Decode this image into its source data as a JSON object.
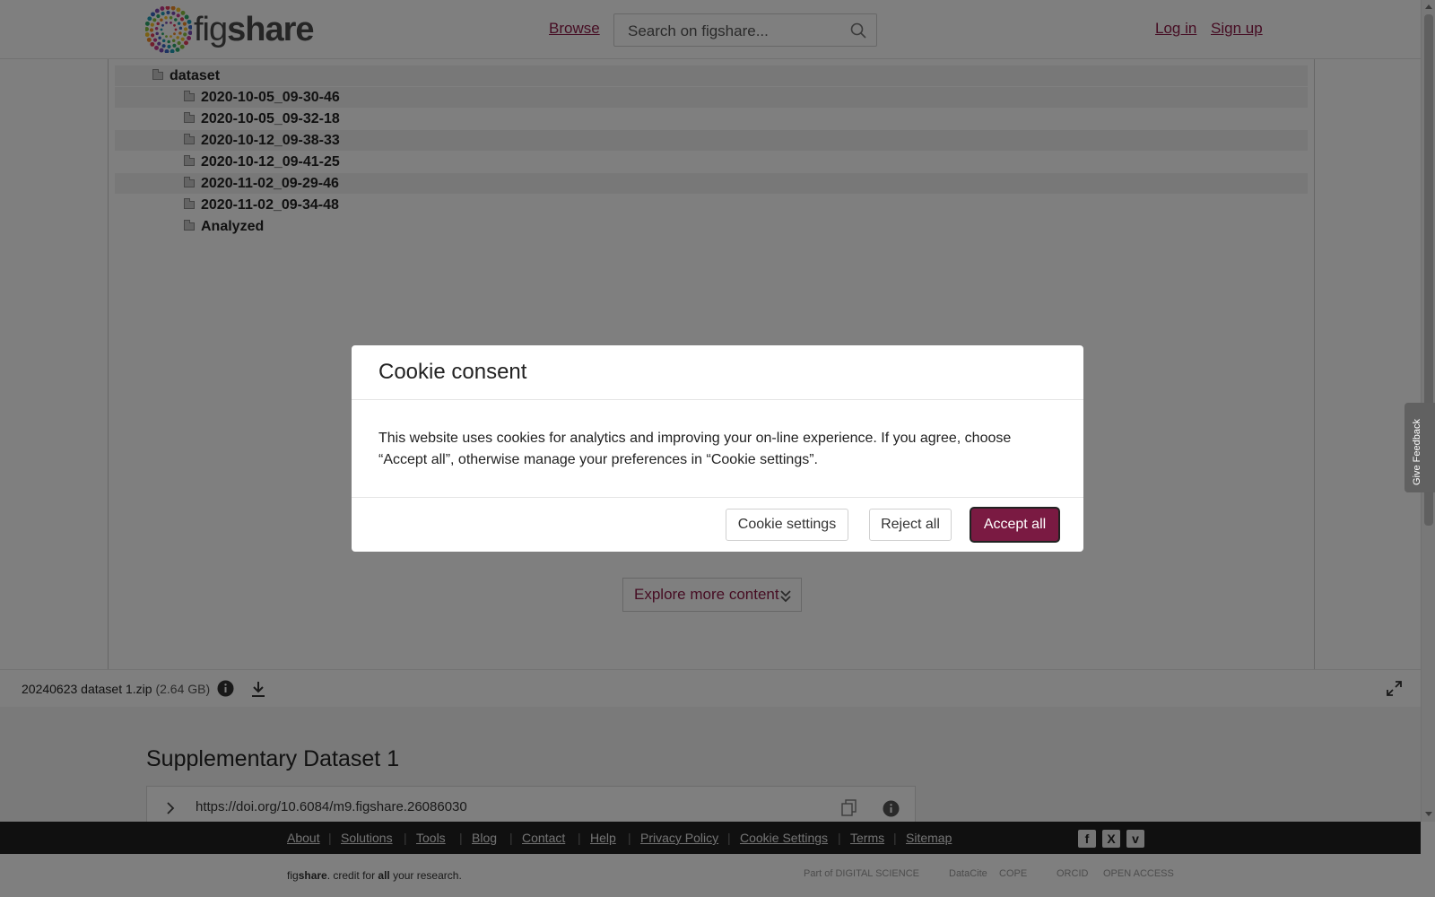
{
  "header": {
    "logo_word_light": "fig",
    "logo_word_bold": "share",
    "browse": "Browse",
    "search_placeholder": "Search on figshare...",
    "login": "Log in",
    "signup": "Sign up"
  },
  "tree": {
    "root": "dataset",
    "children": [
      "2020-10-05_09-30-46",
      "2020-10-05_09-32-18",
      "2020-10-12_09-38-33",
      "2020-10-12_09-41-25",
      "2020-11-02_09-29-46",
      "2020-11-02_09-34-48",
      "Analyzed"
    ]
  },
  "explore": "Explore more content",
  "file": {
    "name": "20240623 dataset 1.zip",
    "size": "(2.64 GB)"
  },
  "item": {
    "title": "Supplementary Dataset 1",
    "doi": "https://doi.org/10.6084/m9.figshare.26086030"
  },
  "footer": {
    "links": [
      "About",
      "Solutions",
      "Tools",
      "Blog",
      "Contact",
      "Help",
      "Privacy Policy",
      "Cookie Settings",
      "Terms",
      "Sitemap"
    ],
    "social": [
      "f",
      "X",
      "v"
    ],
    "tagline_light": "fig",
    "tagline_bold": "share",
    "tagline_rest1": ". credit for ",
    "tagline_all": "all",
    "tagline_rest2": " your research.",
    "partners": [
      "Part of DIGITAL SCIENCE",
      "DataCite",
      "COPE",
      "ORCID",
      "OPEN ACCESS"
    ]
  },
  "feedback": "Give Feedback",
  "modal": {
    "title": "Cookie consent",
    "body": "This website uses cookies for analytics and improving your on-line experience. If you agree, choose “Accept all”, otherwise manage your preferences in “Cookie settings”.",
    "settings": "Cookie settings",
    "reject": "Reject all",
    "accept": "Accept all"
  },
  "colors": {
    "brand": "#8d1a47",
    "accept_button": "#7a1a42",
    "footer_bg": "#202020"
  }
}
